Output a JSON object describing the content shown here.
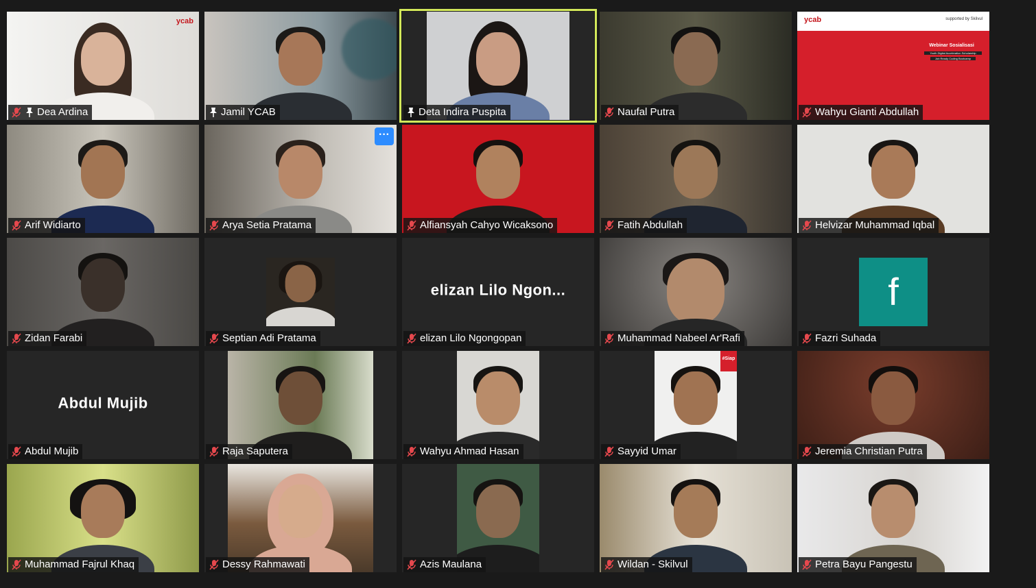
{
  "meeting": {
    "participants": [
      {
        "name": "Dea Ardina",
        "muted": true,
        "pinned": true,
        "logo": "ycab"
      },
      {
        "name": "Jamil YCAB",
        "muted": false,
        "pinned": true
      },
      {
        "name": "Deta Indira Puspita",
        "muted": false,
        "pinned": true,
        "active_speaker": true
      },
      {
        "name": "Naufal Putra",
        "muted": true
      },
      {
        "name": "Wahyu Gianti Abdullah",
        "muted": true,
        "slide": {
          "logo": "ycab",
          "supported_by": "supported by Skilvul",
          "title": "Webinar Sosialisasi",
          "line1": "Youth Digital Acceleration Scholarship",
          "line2": "Job Ready Coding Bootcamp"
        }
      },
      {
        "name": "Arif Widiarto",
        "muted": true
      },
      {
        "name": "Arya Setia Pratama",
        "muted": true,
        "more_button": "···"
      },
      {
        "name": "Alfiansyah Cahyo Wicaksono",
        "muted": true
      },
      {
        "name": "Fatih Abdullah",
        "muted": true
      },
      {
        "name": "Helvizar Muhammad Iqbal",
        "muted": true
      },
      {
        "name": "Zidan Farabi",
        "muted": true
      },
      {
        "name": "Septian Adi Pratama",
        "muted": true
      },
      {
        "name": "elizan Lilo Ngongopan",
        "muted": true,
        "video_off": true,
        "display_name": "elizan Lilo Ngon..."
      },
      {
        "name": "Muhammad Nabeel Ar'Rafi",
        "muted": true
      },
      {
        "name": "Fazri Suhada",
        "muted": true,
        "avatar_letter": "f"
      },
      {
        "name": "Abdul Mujib",
        "muted": true,
        "video_off": true,
        "display_name": "Abdul Mujib"
      },
      {
        "name": "Raja Saputera",
        "muted": true
      },
      {
        "name": "Wahyu Ahmad Hasan",
        "muted": true
      },
      {
        "name": "Sayyid Umar",
        "muted": true,
        "corner_text": "#Siap"
      },
      {
        "name": "Jeremia Christian Putra",
        "muted": true
      },
      {
        "name": "Muhammad Fajrul Khaq",
        "muted": true
      },
      {
        "name": "Dessy Rahmawati",
        "muted": true
      },
      {
        "name": "Azis Maulana",
        "muted": true
      },
      {
        "name": "Wildan - Skilvul",
        "muted": true
      },
      {
        "name": "Petra Bayu Pangestu",
        "muted": true
      }
    ],
    "colors": {
      "active_border": "#d3e85a",
      "muted_icon": "#e5484d",
      "more_button": "#2d8cff",
      "avatar_bg": "#0e8f86"
    }
  }
}
